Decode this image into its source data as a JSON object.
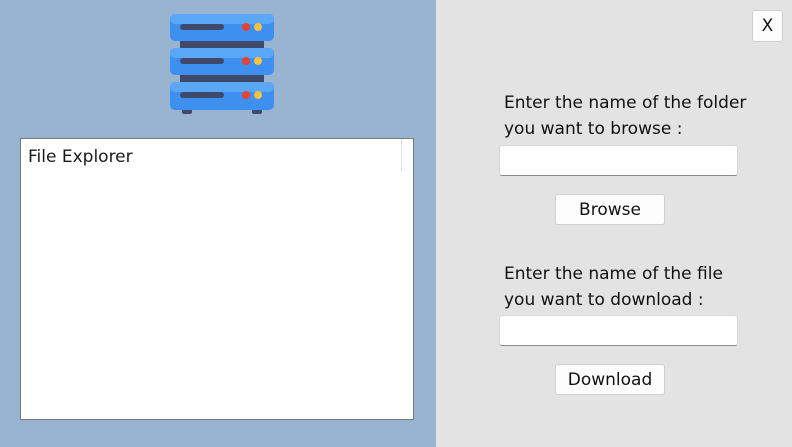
{
  "window": {
    "close_label": "X"
  },
  "logo": {
    "icon": "server-stack-icon"
  },
  "explorer": {
    "header_label": "File Explorer",
    "items": []
  },
  "browse": {
    "prompt_line1": "Enter the name of the folder",
    "prompt_line2": "you want to browse :",
    "input_value": "",
    "button_label": "Browse"
  },
  "download": {
    "prompt_line1": "Enter the name of the file",
    "prompt_line2": "you want to download :",
    "input_value": "",
    "button_label": "Download"
  },
  "colors": {
    "left_panel_bg": "#99b4d1",
    "right_panel_bg": "#e3e3e3",
    "server_blue": "#3d8ff0",
    "server_dark": "#3f4a6b"
  }
}
